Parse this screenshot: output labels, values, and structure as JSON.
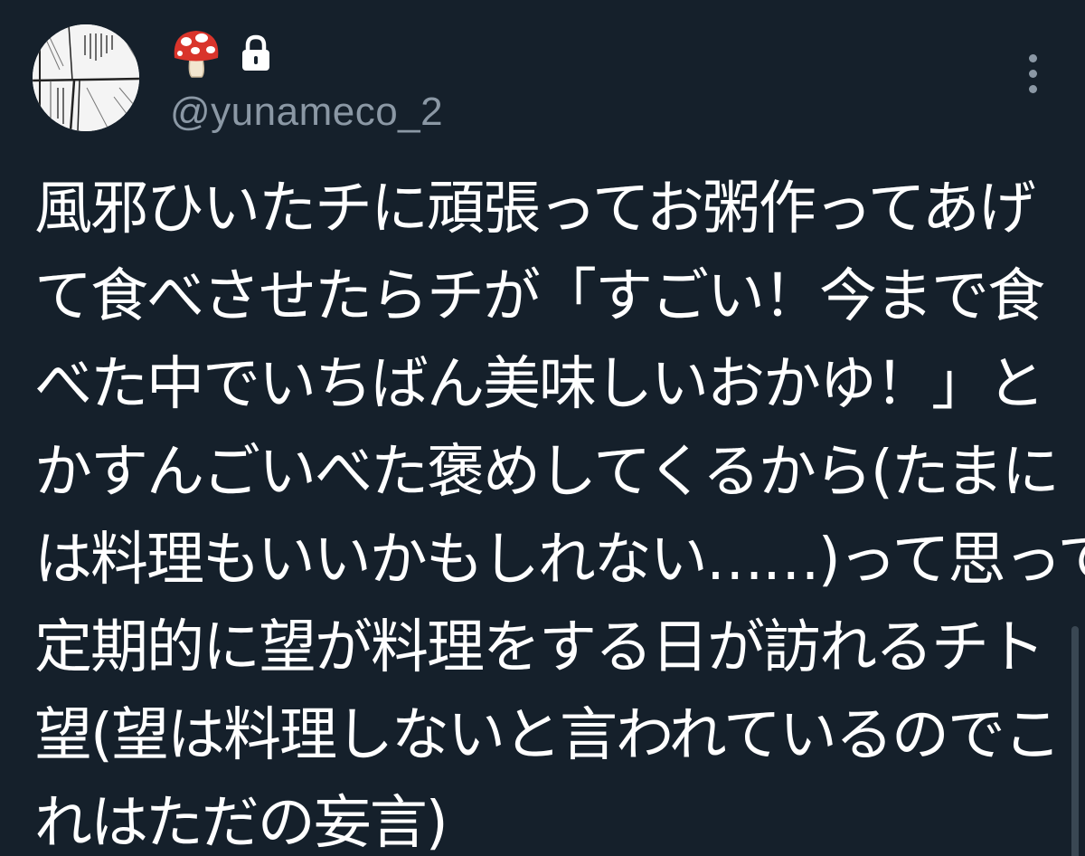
{
  "tweet": {
    "avatar_icon": "manga-panel-avatar",
    "display_name_emoji_icon": "mushroom-icon",
    "protected_icon": "lock-icon",
    "handle": "@yunameco_2",
    "more_icon": "vertical-ellipsis-icon",
    "text_lines": [
      "風邪ひいたチに頑張ってお粥作ってあげ",
      "て食べさせたらチが「すごい！今まで食",
      "べた中でいちばん美味しいおかゆ！」と",
      "かすんごいべた褒めしてくるから(たまに",
      "は料理もいいかもしれない……)って思って",
      "定期的に望が料理をする日が訪れるチト",
      "望(望は料理しないと言われているのでこ",
      "れはただの妄言)"
    ]
  },
  "colors": {
    "background": "#15202b",
    "text": "#ffffff",
    "secondary_text": "#8b98a5",
    "mushroom_red": "#d9342b"
  }
}
